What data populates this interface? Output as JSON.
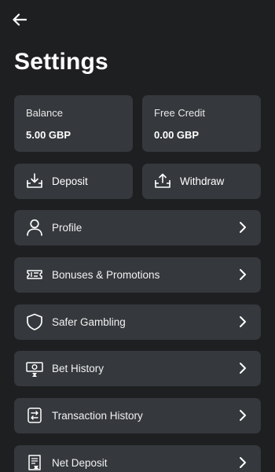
{
  "header": {
    "back_icon": "arrow-left-icon",
    "title": "Settings"
  },
  "balances": [
    {
      "label": "Balance",
      "value": "5.00 GBP"
    },
    {
      "label": "Free Credit",
      "value": "0.00 GBP"
    }
  ],
  "actions": [
    {
      "label": "Deposit",
      "icon": "deposit-icon"
    },
    {
      "label": "Withdraw",
      "icon": "withdraw-icon"
    }
  ],
  "menu": [
    {
      "label": "Profile",
      "icon": "user-icon"
    },
    {
      "label": "Bonuses & Promotions",
      "icon": "ticket-icon"
    },
    {
      "label": "Safer Gambling",
      "icon": "shield-icon"
    },
    {
      "label": "Bet History",
      "icon": "bet-history-icon"
    },
    {
      "label": "Transaction History",
      "icon": "transaction-icon"
    },
    {
      "label": "Net Deposit",
      "icon": "net-deposit-icon"
    }
  ],
  "colors": {
    "background": "#1e1f21",
    "card": "#35383c",
    "text": "#ffffff"
  }
}
